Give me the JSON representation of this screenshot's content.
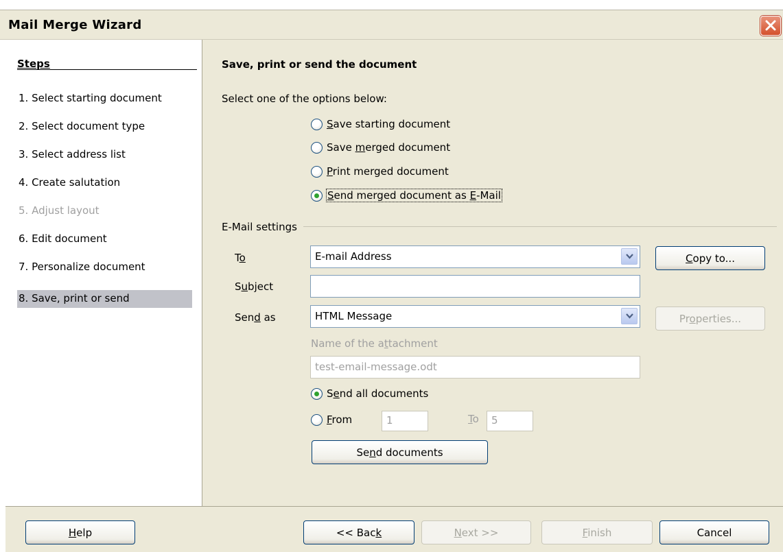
{
  "window": {
    "title": "Mail Merge Wizard"
  },
  "steps": {
    "heading": "Steps",
    "items": [
      {
        "label": "1.  Select starting document",
        "state": "normal"
      },
      {
        "label": "2.  Select document type",
        "state": "normal"
      },
      {
        "label": "3.  Select address list",
        "state": "normal"
      },
      {
        "label": "4.  Create salutation",
        "state": "normal"
      },
      {
        "label": "5.  Adjust layout",
        "state": "disabled"
      },
      {
        "label": "6.  Edit document",
        "state": "normal"
      },
      {
        "label": "7.  Personalize document",
        "state": "normal"
      },
      {
        "label": "8.  Save, print or send",
        "state": "selected"
      }
    ]
  },
  "main": {
    "title": "Save, print or send the document",
    "instruction": "Select one of the options below:",
    "options": [
      {
        "pre": "",
        "key": "S",
        "post": "ave starting document",
        "checked": false
      },
      {
        "pre": "Save ",
        "key": "m",
        "post": "erged document",
        "checked": false
      },
      {
        "pre": "",
        "key": "P",
        "post": "rint merged document",
        "checked": false
      },
      {
        "pre": "",
        "key": "S",
        "post": "end merged document as ",
        "key2": "E",
        "post2": "-Mail",
        "checked": true
      }
    ]
  },
  "email": {
    "group_label": "E-Mail settings",
    "to": {
      "pre": "T",
      "key": "o",
      "post": "",
      "value": "E-mail Address"
    },
    "copy_to": {
      "pre": "",
      "key": "C",
      "post": "opy to..."
    },
    "subject": {
      "pre": "S",
      "key": "u",
      "post": "bject",
      "value": ""
    },
    "send_as": {
      "pre": "Sen",
      "key": "d",
      "post": " as",
      "value": "HTML Message"
    },
    "properties": {
      "pre": "Pr",
      "key": "o",
      "post": "perties..."
    },
    "attachment": {
      "pre": "Name of the a",
      "key": "t",
      "post": "tachment",
      "value": "test-email-message.odt"
    },
    "send_all": {
      "pre": "S",
      "key": "e",
      "post": "nd all documents",
      "checked": true
    },
    "from": {
      "pre": "",
      "key": "F",
      "post": "rom",
      "value": "1",
      "checked": false
    },
    "to_range": {
      "pre": "",
      "key": "T",
      "post": "o",
      "value": "5"
    },
    "send_documents": {
      "pre": "Se",
      "key": "n",
      "post": "d documents"
    }
  },
  "footer": {
    "help": {
      "pre": "",
      "key": "H",
      "post": "elp"
    },
    "back": {
      "pre": "<< Bac",
      "key": "k",
      "post": ""
    },
    "next": {
      "pre": "",
      "key": "N",
      "post": "ext >>"
    },
    "finish": {
      "pre": "",
      "key": "F",
      "post": "inish"
    },
    "cancel": "Cancel"
  },
  "colors": {
    "selected_step": "#c1c2c9",
    "dialog_bg": "#ece9d8",
    "radio_dot": "#2fa22f",
    "close_button": "#d4502c"
  }
}
